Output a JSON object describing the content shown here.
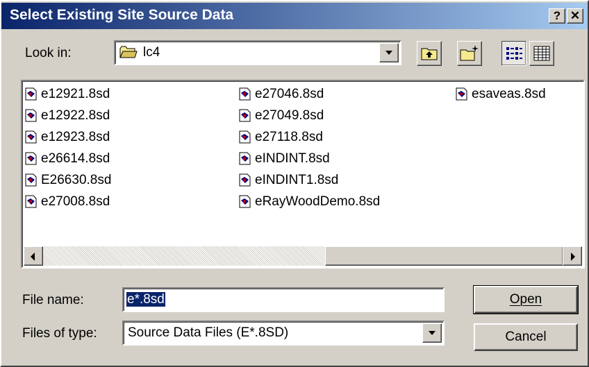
{
  "window": {
    "title": "Select Existing Site Source Data",
    "help_label": "?",
    "close_label": "✕"
  },
  "look_in": {
    "label": "Look in:",
    "value": "lc4",
    "folder_icon": "folder-icon"
  },
  "toolbar": {
    "up_icon": "up-one-level-icon",
    "new_folder_icon": "new-folder-icon",
    "list_view_icon": "list-view-icon",
    "details_view_icon": "details-view-icon",
    "active_view": "list"
  },
  "files": {
    "col1": [
      "e12921.8sd",
      "e12922.8sd",
      "e12923.8sd",
      "e26614.8sd",
      "E26630.8sd",
      "e27008.8sd"
    ],
    "col2": [
      "e27046.8sd",
      "e27049.8sd",
      "e27118.8sd",
      "eINDINT.8sd",
      "eINDINT1.8sd",
      "eRayWoodDemo.8sd"
    ],
    "col3": [
      "esaveas.8sd"
    ]
  },
  "file_name": {
    "label": "File name:",
    "value": "e*.8sd"
  },
  "files_of_type": {
    "label": "Files of type:",
    "value": "Source Data Files (E*.8SD)"
  },
  "buttons": {
    "open": "Open",
    "cancel": "Cancel"
  }
}
